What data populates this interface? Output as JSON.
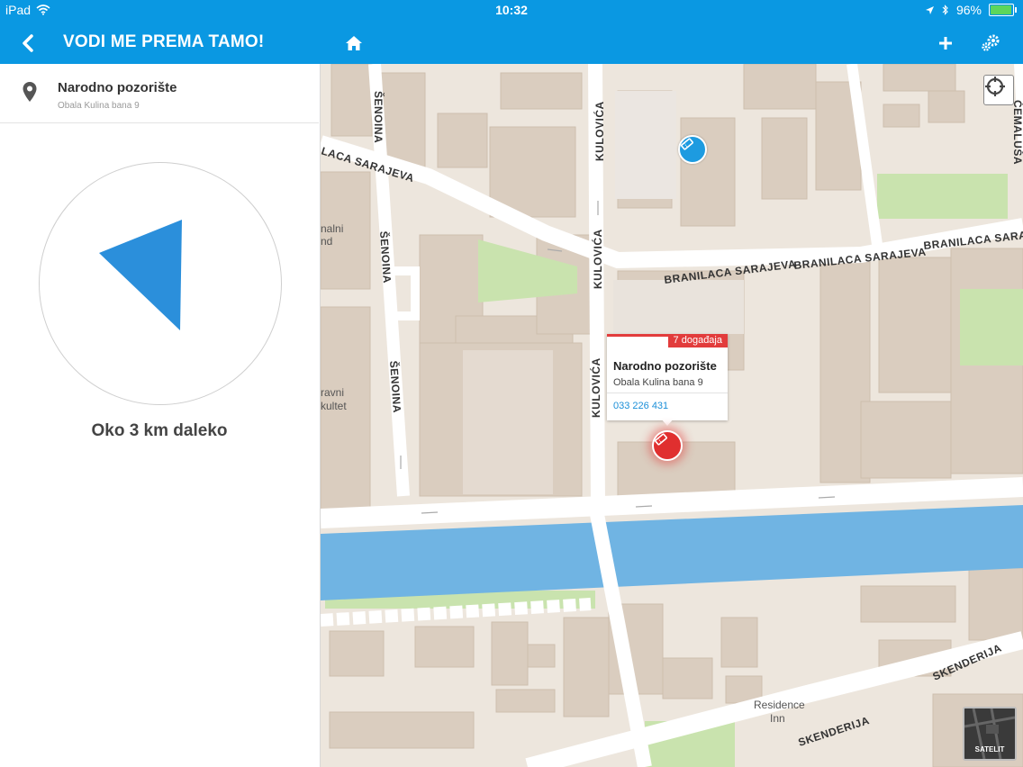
{
  "status_bar": {
    "device": "iPad",
    "time": "10:32",
    "battery": "96%",
    "battery_level": 0.96
  },
  "header": {
    "title": "VODI ME PREMA TAMO!",
    "icons": {
      "back": "chevron-left-icon",
      "home": "home-icon",
      "add": "plus-icon",
      "settings": "gears-icon"
    }
  },
  "destination": {
    "name": "Narodno pozorište",
    "address": "Obala Kulina bana 9"
  },
  "compass": {
    "distance_text": "Oko 3 km daleko",
    "arrow_color": "#2b8fdb"
  },
  "map": {
    "streets": {
      "senoina_1": "ŠENOINA",
      "senoina_2": "ŠENOINA",
      "senoina_3": "ŠENOINA",
      "kulovica_1": "KULOVIĆA",
      "kulovica_2": "KULOVIĆA",
      "kulovica_3": "KULOVIĆA",
      "branilaca_left": "LACA SARAJEVA",
      "branilaca_1": "BRANILACA SARAJEVA",
      "branilaca_2": "BRANILACA SARAJEVA",
      "branilaca_3": "BRANILACA SARAJE",
      "cemalusa": "ĆEMALUŠA",
      "skenderija_1": "SKENDERIJA",
      "skenderija_2": "SKENDERIJA"
    },
    "poi_labels": {
      "nalni": "nalni",
      "nd": "nd",
      "ravni": "ravni",
      "kultet": "kultet",
      "residence_1": "Residence",
      "residence_2": "Inn"
    },
    "popup": {
      "badge": "7 događaja",
      "name": "Narodno pozorište",
      "address": "Obala Kulina bana 9",
      "phone": "033 226 431"
    },
    "satellite_label": "SATELIT",
    "colors": {
      "background": "#ede6dd",
      "building": "#d9cdbf",
      "road": "#ffffff",
      "river": "#70b4e3",
      "park": "#c9e3ae",
      "marker_blue": "#1d9be0",
      "marker_red": "#e02f2f"
    }
  }
}
